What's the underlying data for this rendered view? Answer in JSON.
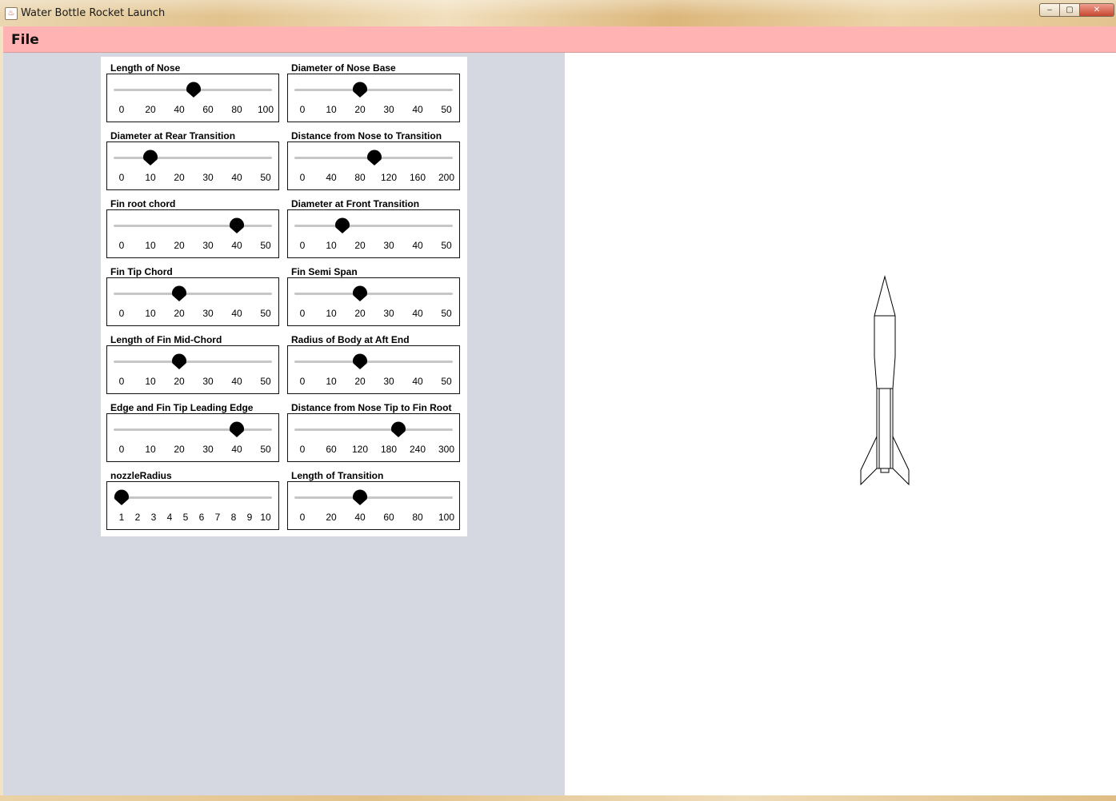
{
  "window": {
    "title": "Water Bottle Rocket Launch",
    "icon": "java-cup-icon",
    "controls": [
      "minimize",
      "maximize",
      "close"
    ]
  },
  "menubar": {
    "items": [
      {
        "label": "File"
      }
    ]
  },
  "sliders": [
    {
      "label": "Length of Nose",
      "ticks": [
        "0",
        "20",
        "40",
        "60",
        "80",
        "100"
      ],
      "min": 0,
      "max": 100,
      "value": 50
    },
    {
      "label": "Diameter of Nose Base",
      "ticks": [
        "0",
        "10",
        "20",
        "30",
        "40",
        "50"
      ],
      "min": 0,
      "max": 50,
      "value": 20
    },
    {
      "label": "Diameter at Rear Transition",
      "ticks": [
        "0",
        "10",
        "20",
        "30",
        "40",
        "50"
      ],
      "min": 0,
      "max": 50,
      "value": 10
    },
    {
      "label": "Distance from Nose to Transition",
      "ticks": [
        "0",
        "40",
        "80",
        "120",
        "160",
        "200"
      ],
      "min": 0,
      "max": 200,
      "value": 100
    },
    {
      "label": "Fin root chord",
      "ticks": [
        "0",
        "10",
        "20",
        "30",
        "40",
        "50"
      ],
      "min": 0,
      "max": 50,
      "value": 40
    },
    {
      "label": "Diameter at Front Transition",
      "ticks": [
        "0",
        "10",
        "20",
        "30",
        "40",
        "50"
      ],
      "min": 0,
      "max": 50,
      "value": 14
    },
    {
      "label": "Fin Tip Chord",
      "ticks": [
        "0",
        "10",
        "20",
        "30",
        "40",
        "50"
      ],
      "min": 0,
      "max": 50,
      "value": 20
    },
    {
      "label": "Fin Semi Span",
      "ticks": [
        "0",
        "10",
        "20",
        "30",
        "40",
        "50"
      ],
      "min": 0,
      "max": 50,
      "value": 20
    },
    {
      "label": "Length of Fin Mid-Chord",
      "ticks": [
        "0",
        "10",
        "20",
        "30",
        "40",
        "50"
      ],
      "min": 0,
      "max": 50,
      "value": 20
    },
    {
      "label": "Radius of Body at Aft End",
      "ticks": [
        "0",
        "10",
        "20",
        "30",
        "40",
        "50"
      ],
      "min": 0,
      "max": 50,
      "value": 20
    },
    {
      "label": "Edge and Fin Tip Leading Edge",
      "ticks": [
        "0",
        "10",
        "20",
        "30",
        "40",
        "50"
      ],
      "min": 0,
      "max": 50,
      "value": 40
    },
    {
      "label": "Distance from Nose Tip to Fin Root",
      "ticks": [
        "0",
        "60",
        "120",
        "180",
        "240",
        "300"
      ],
      "min": 0,
      "max": 300,
      "value": 200
    },
    {
      "label": "nozzleRadius",
      "ticks": [
        "1",
        "2",
        "3",
        "4",
        "5",
        "6",
        "7",
        "8",
        "9",
        "10"
      ],
      "min": 1,
      "max": 10,
      "value": 1
    },
    {
      "label": "Length of Transition",
      "ticks": [
        "0",
        "20",
        "40",
        "60",
        "80",
        "100"
      ],
      "min": 0,
      "max": 100,
      "value": 40
    }
  ],
  "canvas": {
    "drawing": "rocket-outline",
    "stroke_color": "#000000",
    "background": "#ffffff"
  },
  "colors": {
    "menubar": "#ffb3b3",
    "left_pane": "#d5d8e0",
    "panel": "#ffffff",
    "slider_thumb": "#000000",
    "slider_track": "#c6c6c6"
  }
}
